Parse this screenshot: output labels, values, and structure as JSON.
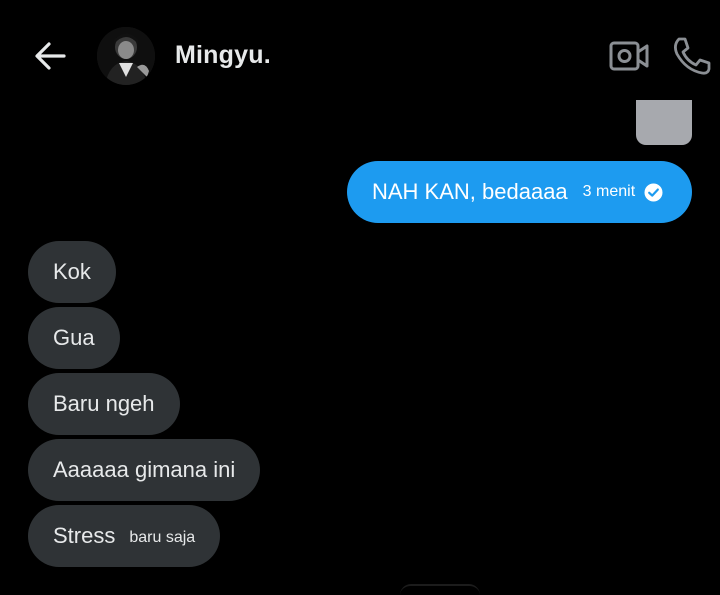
{
  "header": {
    "contact_name": "Mingyu.",
    "back_icon": "arrow-left-icon",
    "video_icon": "video-camera-icon",
    "call_icon": "phone-icon"
  },
  "sent_message": {
    "text": "NAH KAN, bedaaaa",
    "time": "3 menit",
    "status_icon": "read-check-icon"
  },
  "received_messages": [
    {
      "text": "Kok"
    },
    {
      "text": "Gua"
    },
    {
      "text": "Baru ngeh"
    },
    {
      "text": "Aaaaaa gimana ini"
    },
    {
      "text": "Stress",
      "time": "baru saja"
    }
  ],
  "colors": {
    "background": "#000000",
    "sent_bubble": "#1d9bf0",
    "received_bubble": "#2f3336",
    "text": "#e7e9ea"
  }
}
